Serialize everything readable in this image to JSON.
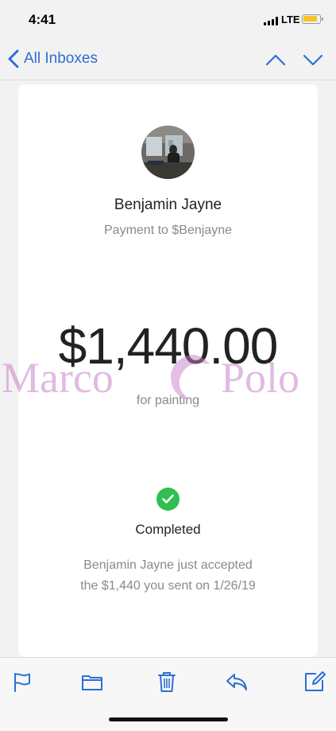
{
  "status_bar": {
    "time": "4:41",
    "network": "LTE",
    "battery_color": "#f5c623"
  },
  "nav": {
    "back_label": "All Inboxes",
    "up_icon": "chevron-up-icon",
    "down_icon": "chevron-down-icon"
  },
  "receipt": {
    "recipient_name": "Benjamin Jayne",
    "payment_to": "Payment to $Benjayne",
    "amount": "$1,440.00",
    "memo": "for painting",
    "status": "Completed",
    "message_line1": "Benjamin Jayne just accepted",
    "message_line2": "the $1,440 you sent on 1/26/19",
    "status_color": "#2fbf4f"
  },
  "watermark": {
    "left": "Marco",
    "right": "Polo"
  },
  "toolbar": {
    "icons": [
      "flag-icon",
      "folder-icon",
      "trash-icon",
      "reply-icon",
      "compose-icon"
    ]
  },
  "colors": {
    "accent": "#2b6fd6"
  }
}
